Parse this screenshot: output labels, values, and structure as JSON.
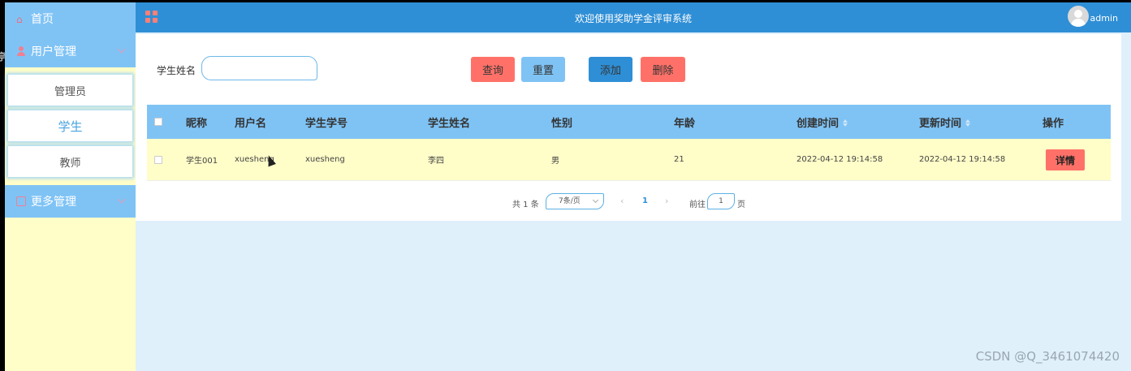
{
  "sidebar": {
    "home": "首页",
    "user_mgmt": "用户管理",
    "items": [
      "管理员",
      "学生",
      "教师"
    ],
    "more_mgmt": "更多管理"
  },
  "header": {
    "title": "欢迎使用奖助学金评审系统",
    "user": "admin"
  },
  "search": {
    "label": "学生姓名",
    "value": ""
  },
  "buttons": {
    "query": "查询",
    "reset": "重置",
    "add": "添加",
    "delete": "删除",
    "detail": "详情"
  },
  "table": {
    "headers": [
      "昵称",
      "用户名",
      "学生学号",
      "学生姓名",
      "性别",
      "年龄",
      "创建时间",
      "更新时间",
      "操作"
    ],
    "rows": [
      {
        "nickname": "学生001",
        "username": "xuesheng",
        "student_no": "xuesheng",
        "student_name": "李四",
        "gender": "男",
        "age": "21",
        "created": "2022-04-12 19:14:58",
        "updated": "2022-04-12 19:14:58"
      }
    ]
  },
  "pager": {
    "total": "共 1 条",
    "page_size": "7条/页",
    "current": "1",
    "goto": "前往",
    "goto_value": "1",
    "unit": "页"
  },
  "watermark": "CSDN @Q_3461074420",
  "edge_char": "亭"
}
